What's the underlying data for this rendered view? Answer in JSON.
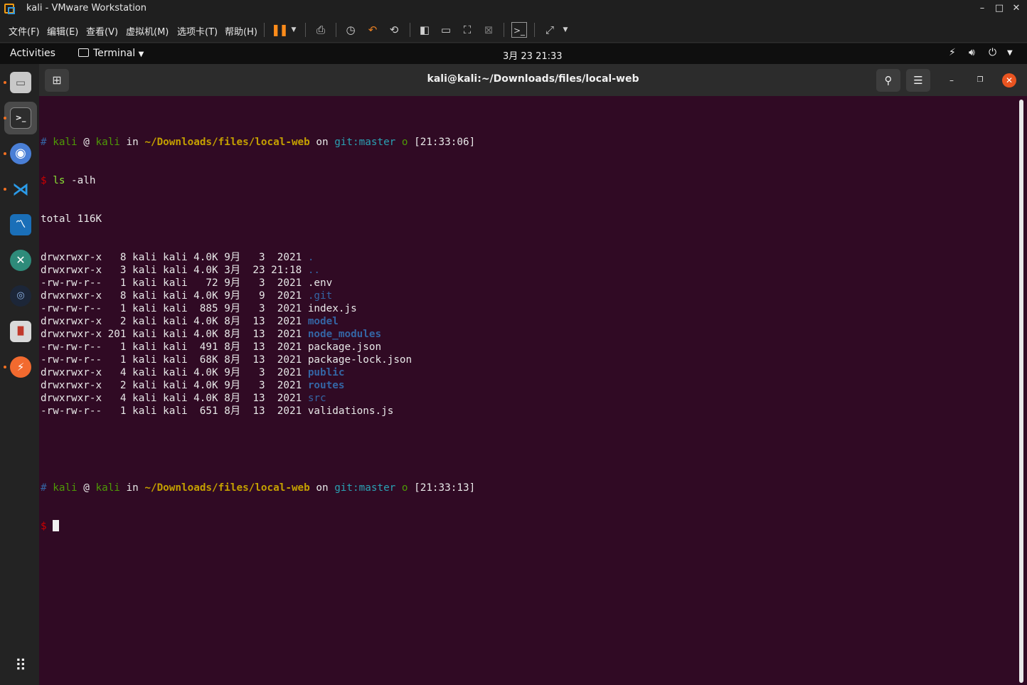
{
  "vmware": {
    "title": "kali - VMware Workstation",
    "menus": [
      "文件(F)",
      "编辑(E)",
      "查看(V)",
      "虚拟机(M)",
      "选项卡(T)",
      "帮助(H)"
    ],
    "controls": {
      "minimize": "–",
      "maximize": "□",
      "close": "✕"
    }
  },
  "gnome": {
    "activities": "Activities",
    "app_menu": "Terminal",
    "clock": "3月 23  21:33"
  },
  "terminal": {
    "title": "kali@kali:~/Downloads/files/local-web",
    "prompt1": {
      "hash": "#",
      "user": "kali",
      "at": "@",
      "host": "kali",
      "in": "in",
      "path": "~/Downloads/files/local-web",
      "on": "on",
      "git": "git:master",
      "o": "o",
      "time": "[21:33:06]"
    },
    "command": {
      "dollar": "$",
      "cmd": "ls",
      "args": " -alh"
    },
    "total": "total 116K",
    "listing": [
      {
        "meta": "drwxrwxr-x   8 kali kali 4.0K 9月   3  2021 ",
        "name": ".",
        "kind": "dir"
      },
      {
        "meta": "drwxrwxr-x   3 kali kali 4.0K 3月  23 21:18 ",
        "name": "..",
        "kind": "dir"
      },
      {
        "meta": "-rw-rw-r--   1 kali kali   72 9月   3  2021 ",
        "name": ".env",
        "kind": "file"
      },
      {
        "meta": "drwxrwxr-x   8 kali kali 4.0K 9月   9  2021 ",
        "name": ".git",
        "kind": "dir"
      },
      {
        "meta": "-rw-rw-r--   1 kali kali  885 9月   3  2021 ",
        "name": "index.js",
        "kind": "file"
      },
      {
        "meta": "drwxrwxr-x   2 kali kali 4.0K 8月  13  2021 ",
        "name": "model",
        "kind": "dirb"
      },
      {
        "meta": "drwxrwxr-x 201 kali kali 4.0K 8月  13  2021 ",
        "name": "node_modules",
        "kind": "dirb"
      },
      {
        "meta": "-rw-rw-r--   1 kali kali  491 8月  13  2021 ",
        "name": "package.json",
        "kind": "file"
      },
      {
        "meta": "-rw-rw-r--   1 kali kali  68K 8月  13  2021 ",
        "name": "package-lock.json",
        "kind": "file"
      },
      {
        "meta": "drwxrwxr-x   4 kali kali 4.0K 9月   3  2021 ",
        "name": "public",
        "kind": "dirb"
      },
      {
        "meta": "drwxrwxr-x   2 kali kali 4.0K 9月   3  2021 ",
        "name": "routes",
        "kind": "dirb"
      },
      {
        "meta": "drwxrwxr-x   4 kali kali 4.0K 8月  13  2021 ",
        "name": "src",
        "kind": "dir"
      },
      {
        "meta": "-rw-rw-r--   1 kali kali  651 8月  13  2021 ",
        "name": "validations.js",
        "kind": "file"
      }
    ],
    "prompt2": {
      "time": "[21:33:13]"
    }
  },
  "dock": [
    "files-icon",
    "terminal-icon",
    "chromium-icon",
    "vscode-icon",
    "system-monitor-icon",
    "crossover-icon",
    "vpn-icon",
    "parallels-icon",
    "burpsuite-icon"
  ]
}
